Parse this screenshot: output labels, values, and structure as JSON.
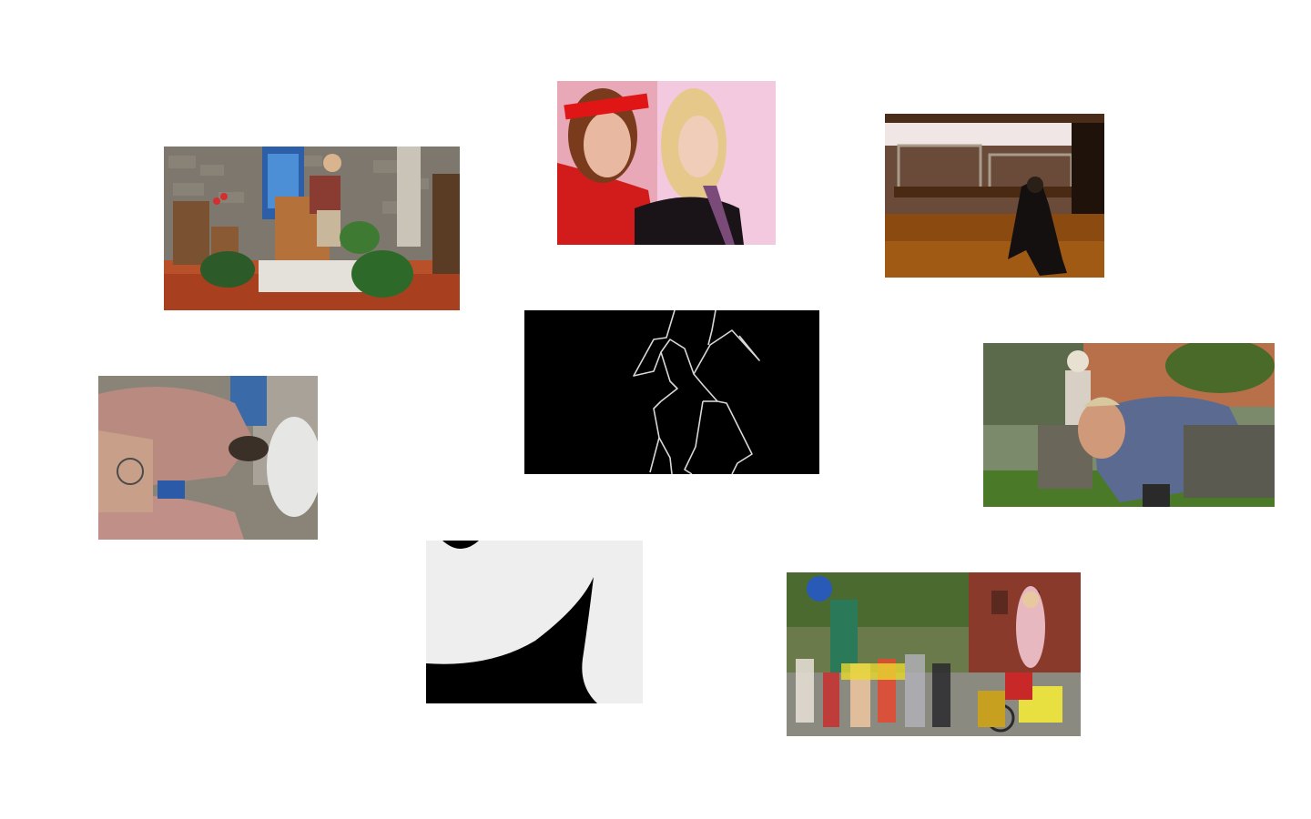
{
  "gallery": {
    "tiles": [
      {
        "id": "church-dancer",
        "icon": "photo-thumbnail"
      },
      {
        "id": "two-women-portrait",
        "icon": "photo-thumbnail"
      },
      {
        "id": "dance-hall",
        "icon": "photo-thumbnail"
      },
      {
        "id": "stick-figure",
        "icon": "animation-thumbnail"
      },
      {
        "id": "hands-closeup",
        "icon": "photo-thumbnail"
      },
      {
        "id": "mohawk-man",
        "icon": "photo-thumbnail"
      },
      {
        "id": "black-white-shape",
        "icon": "graphic-thumbnail"
      },
      {
        "id": "street-parade",
        "icon": "photo-thumbnail"
      }
    ]
  },
  "colors": {
    "background": "#ffffff",
    "stick_bg": "#000000",
    "stick_line": "#d8d8d8",
    "bw_light": "#eeeeee",
    "bw_dark": "#000000"
  }
}
